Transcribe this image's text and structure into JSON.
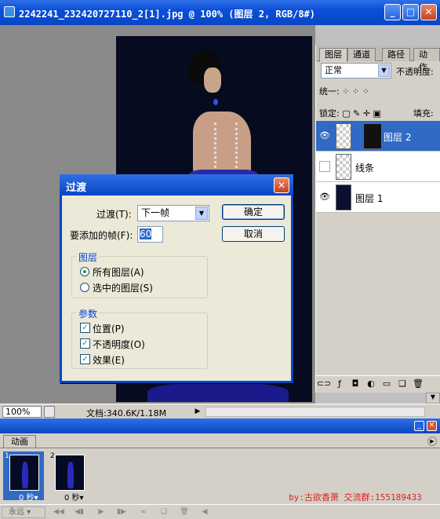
{
  "window": {
    "title": "2242241_232420727110_2[1].jpg @ 100% (图层 2, RGB/8#)",
    "zoom": "100%",
    "doc_info": "文档:340.6K/1.18M"
  },
  "layers_panel": {
    "tabs": [
      "图层",
      "通道",
      "路径",
      "动作"
    ],
    "blend_mode": "正常",
    "opacity_label": "不透明度:",
    "unify_label": "统一:",
    "lock_label": "锁定:",
    "fill_label": "填充:",
    "layers": [
      {
        "name": "图层 2",
        "visible": true,
        "selected": true
      },
      {
        "name": "线条",
        "visible": false,
        "selected": false
      },
      {
        "name": "图层 1",
        "visible": true,
        "selected": false
      }
    ]
  },
  "dialog": {
    "title": "过渡",
    "tween_label": "过渡(T):",
    "tween_value": "下一帧",
    "frames_label": "要添加的帧(F):",
    "frames_value": "60",
    "ok_label": "确定",
    "cancel_label": "取消",
    "layers_group": "图层",
    "all_layers": "所有图层(A)",
    "selected_layers": "选中的图层(S)",
    "params_group": "参数",
    "position": "位置(P)",
    "opacity": "不透明度(O)",
    "effects": "效果(E)"
  },
  "animation": {
    "tab": "动画",
    "frames": [
      {
        "num": "1",
        "delay": "0 秒▾"
      },
      {
        "num": "2",
        "delay": "0 秒▾"
      }
    ],
    "loop": "永远",
    "credit": "by:古欲香萧 交流群:155189433"
  }
}
